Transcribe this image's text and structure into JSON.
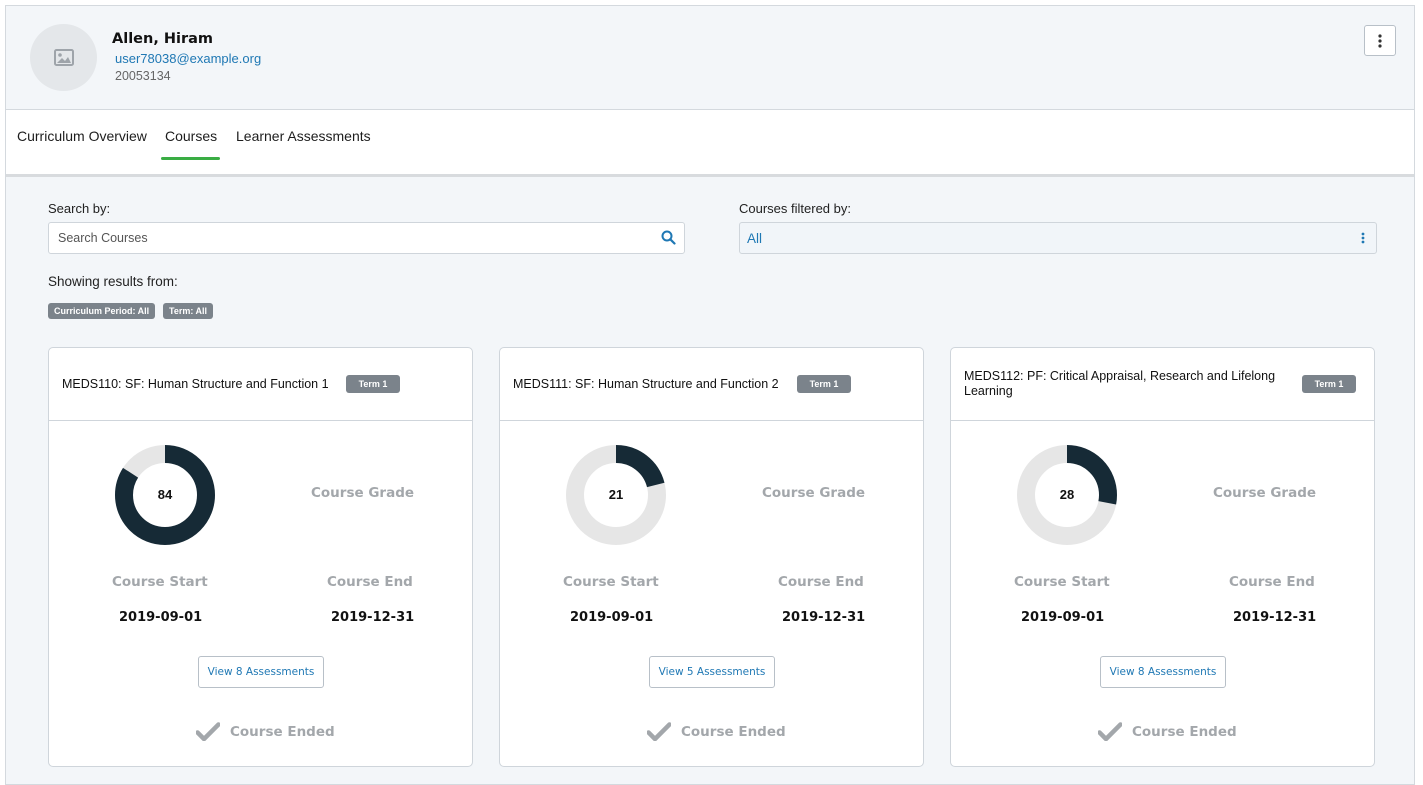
{
  "profile": {
    "name": "Allen, Hiram",
    "email": "user78038@example.org",
    "id": "20053134"
  },
  "tabs": [
    {
      "label": "Curriculum Overview"
    },
    {
      "label": "Courses",
      "active": true
    },
    {
      "label": "Learner Assessments"
    }
  ],
  "search": {
    "label": "Search by:",
    "placeholder": "Search Courses",
    "value": ""
  },
  "filter": {
    "label": "Courses filtered by:",
    "value": "All"
  },
  "results": {
    "label": "Showing results from:",
    "chips": [
      "Curriculum Period: All",
      "Term: All"
    ]
  },
  "labels": {
    "grade": "Course Grade",
    "start": "Course Start",
    "end": "Course End",
    "ended": "Course Ended"
  },
  "courses": [
    {
      "title": "MEDS110: SF: Human Structure and Function 1",
      "term": "Term 1",
      "grade": 84,
      "start": "2019-09-01",
      "end": "2019-12-31",
      "button": "View 8 Assessments"
    },
    {
      "title": "MEDS111: SF: Human Structure and Function 2",
      "term": "Term 1",
      "grade": 21,
      "start": "2019-09-01",
      "end": "2019-12-31",
      "button": "View 5 Assessments"
    },
    {
      "title": "MEDS112: PF: Critical Appraisal, Research and Lifelong Learning",
      "term": "Term 1",
      "grade": 28,
      "start": "2019-09-01",
      "end": "2019-12-31",
      "button": "View 8 Assessments"
    }
  ],
  "colors": {
    "accent": "#1f78b4",
    "active_tab": "#3aad44",
    "donut_fill": "#162a36",
    "donut_track": "#e6e6e6",
    "badge": "#7b838b"
  },
  "icons": {
    "avatar": "image-placeholder-icon",
    "menu": "kebab-menu-icon",
    "search": "search-icon",
    "filter": "kebab-vertical-icon",
    "ended": "checkmark-icon"
  }
}
